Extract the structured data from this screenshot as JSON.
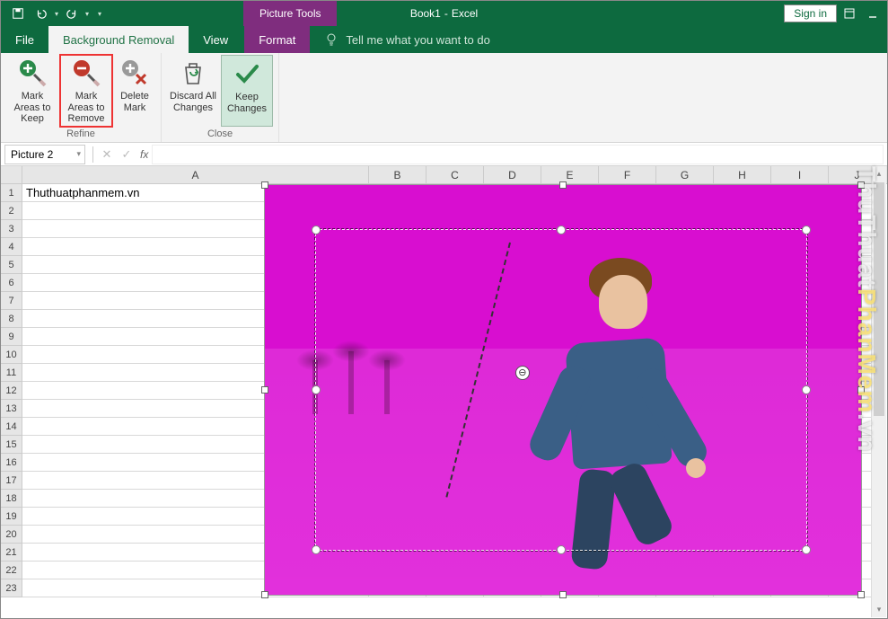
{
  "title": {
    "doc": "Book1",
    "app": "Excel",
    "context_label": "Picture Tools"
  },
  "qat": {
    "save": "save-icon",
    "undo": "undo-icon",
    "redo": "redo-icon",
    "customize": "dropdown-icon"
  },
  "account": {
    "signin": "Sign in"
  },
  "tabs": {
    "file": "File",
    "bg_removal": "Background Removal",
    "view": "View",
    "format": "Format",
    "tell_me": "Tell me what you want to do"
  },
  "ribbon": {
    "refine": {
      "label": "Refine",
      "mark_keep": "Mark Areas to Keep",
      "mark_remove": "Mark Areas to Remove",
      "delete_mark": "Delete Mark"
    },
    "close": {
      "label": "Close",
      "discard": "Discard All Changes",
      "keep": "Keep Changes"
    }
  },
  "namebox": {
    "value": "Picture 2"
  },
  "formula": {
    "cancel": "✕",
    "enter": "✓",
    "fx": "fx"
  },
  "columns": [
    "A",
    "B",
    "C",
    "D",
    "E",
    "F",
    "G",
    "H",
    "I",
    "J"
  ],
  "rows": [
    "1",
    "2",
    "3",
    "4",
    "5",
    "6",
    "7",
    "8",
    "9",
    "10",
    "11",
    "12",
    "13",
    "14",
    "15",
    "16",
    "17",
    "18",
    "19",
    "20",
    "21",
    "22",
    "23"
  ],
  "cells": {
    "A1": "Thuthuatphanmem.vn"
  },
  "mark_badge": "⊖",
  "watermark": {
    "t1": "ThuThuat",
    "t2": "PhanMem",
    "t3": ".vn"
  }
}
